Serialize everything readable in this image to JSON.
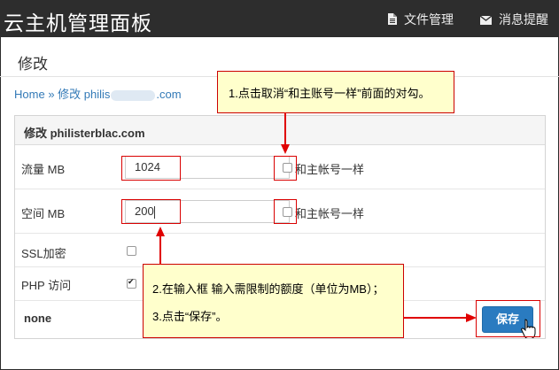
{
  "header": {
    "brand": "云主机管理面板",
    "nav": [
      {
        "label": "文件管理",
        "icon": "file-icon"
      },
      {
        "label": "消息提醒",
        "icon": "envelope-icon"
      }
    ]
  },
  "page": {
    "title": "修改",
    "breadcrumb": {
      "home": "Home",
      "sep": "»",
      "prefix": "修改 philis",
      "suffix": ".com"
    }
  },
  "panel": {
    "heading": "修改 philisterblac.com",
    "rows": [
      {
        "label": "流量 MB",
        "value": "1024",
        "same_label": "和主帐号一样"
      },
      {
        "label": "空间 MB",
        "value": "200",
        "same_label": "和主帐号一样"
      },
      {
        "label": "SSL加密"
      },
      {
        "label": "PHP 访问"
      }
    ],
    "footer_label": "none",
    "save_label": "保存"
  },
  "callouts": {
    "step1": "1.点击取消“和主账号一样”前面的对勾。",
    "step2": "2.在输入框 输入需限制的额度（单位为MB）；",
    "step3": "3.点击“保存”。"
  },
  "colors": {
    "topbar": "#2d2d2d",
    "accent": "#2a7bc0",
    "annotation": "#d90000",
    "callout_bg": "#ffffcc"
  }
}
